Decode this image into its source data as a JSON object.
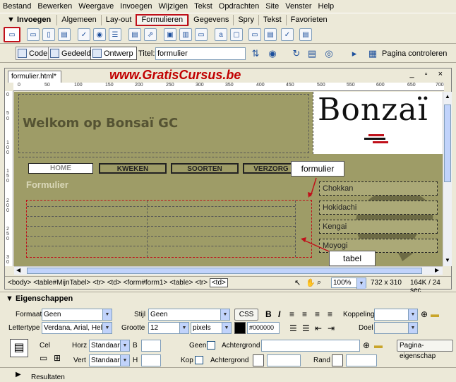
{
  "menubar": [
    "Bestand",
    "Bewerken",
    "Weergave",
    "Invoegen",
    "Wijzigen",
    "Tekst",
    "Opdrachten",
    "Site",
    "Venster",
    "Help"
  ],
  "insert_panel": {
    "header": "▼ Invoegen",
    "tabs": [
      "Algemeen",
      "Lay-out",
      "Formulieren",
      "Gegevens",
      "Spry",
      "Tekst",
      "Favorieten"
    ],
    "active_tab": "Formulieren"
  },
  "doc_toolbar": {
    "code_label": "Code",
    "split_label": "Gedeeld",
    "design_label": "Ontwerp",
    "title_label": "Titel:",
    "title_value": "formulier",
    "check_page_label": "Pagina controleren"
  },
  "document": {
    "tab_label": "formulier.html*",
    "watermark": "www.GratisCursus.be",
    "ruler_h": [
      "0",
      "50",
      "100",
      "150",
      "200",
      "250",
      "300",
      "350",
      "400",
      "450",
      "500",
      "550",
      "600",
      "650",
      "700"
    ],
    "ruler_v": [
      "0",
      "5",
      "0",
      "1 0 0",
      "1 5 0",
      "2 0 0",
      "2 5 0",
      "3 0"
    ],
    "site_title": "Welkom op Bonsaï GC",
    "logo_text": "Bonzaï",
    "nav": [
      "HOME",
      "KWEKEN",
      "SOORTEN",
      "VERZORG"
    ],
    "form_heading": "Formulier",
    "side_menu": [
      "Chokkan",
      "Hokidachi",
      "Kengai",
      "Moyogi"
    ],
    "callouts": {
      "form": "formulier",
      "table": "tabel"
    }
  },
  "statusbar": {
    "tags": [
      "<body>",
      "<table#MijnTabel>",
      "<tr>",
      "<td>",
      "<form#form1>",
      "<table>",
      "<tr>",
      "<td>"
    ],
    "zoom": "100%",
    "window_size": "732 x 310",
    "download": "164K / 24 sec"
  },
  "properties": {
    "title": "Eigenschappen",
    "format_label": "Formaat",
    "format_value": "Geen",
    "style_label": "Stijl",
    "style_value": "Geen",
    "css_label": "CSS",
    "link_label": "Koppeling",
    "font_label": "Lettertype",
    "font_value": "Verdana, Arial, Hel",
    "size_label": "Grootte",
    "size_value": "12",
    "unit_value": "pixels",
    "color_value": "#000000",
    "target_label": "Doel",
    "cell_label": "Cel",
    "horz_label": "Horz",
    "horz_value": "Standaard",
    "vert_label": "Vert",
    "vert_value": "Standaard",
    "w_label": "B",
    "h_label": "H",
    "nowrap_label": "Geen",
    "header_label": "Kop",
    "bg_label": "Achtergrond",
    "bg2_label": "Achtergrond",
    "border_label": "Rand",
    "page_props_label": "Pagina-eigenschap"
  },
  "results_label": "Resultaten",
  "colors": {
    "canvas_bg": "#9e9c67",
    "highlight_red": "#c0101a",
    "watermark_red": "#c10000"
  }
}
